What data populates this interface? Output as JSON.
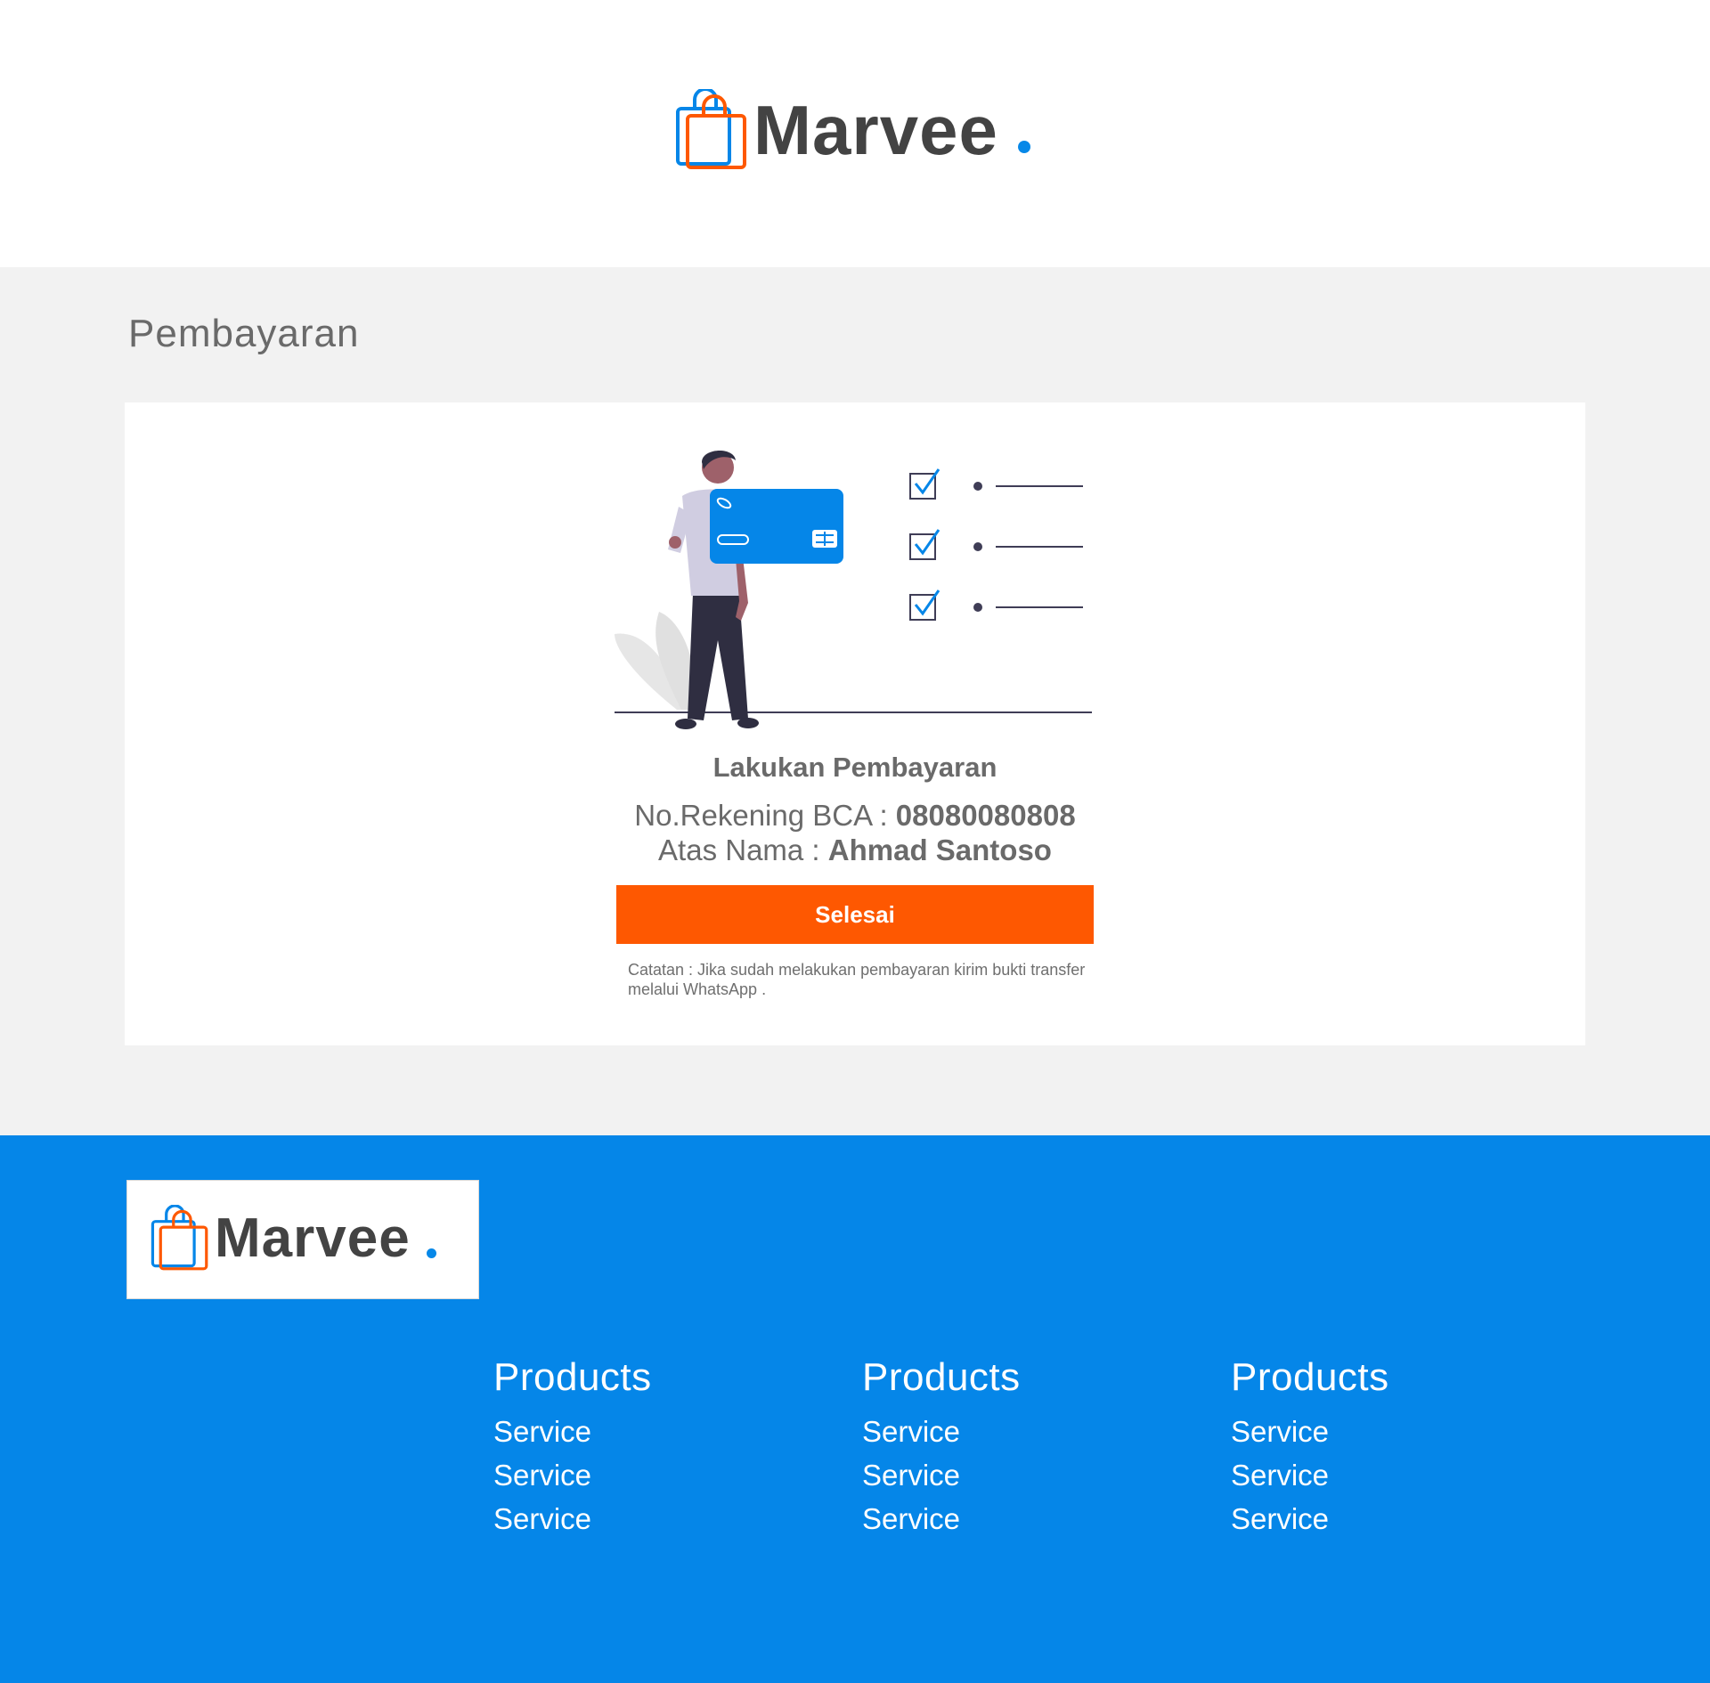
{
  "brand": {
    "name": "Marvee",
    "colors": {
      "primary": "#0586e8",
      "accent": "#fe5801",
      "text": "#434343"
    }
  },
  "payment": {
    "section_title": "Pembayaran",
    "heading": "Lakukan Pembayaran",
    "account_label": "No.Rekening BCA : ",
    "account_number": "08080080808",
    "name_label": "Atas Nama : ",
    "account_name": "Ahmad Santoso",
    "done_button": "Selesai",
    "note": "Catatan : Jika sudah melakukan pembayaran kirim bukti transfer melalui WhatsApp ."
  },
  "footer": {
    "columns": [
      {
        "title": "Products",
        "links": [
          "Service",
          "Service",
          "Service"
        ]
      },
      {
        "title": "Products",
        "links": [
          "Service",
          "Service",
          "Service"
        ]
      },
      {
        "title": "Products",
        "links": [
          "Service",
          "Service",
          "Service"
        ]
      }
    ]
  },
  "icons": [
    "shopping-bag-icon",
    "checkbox-icon",
    "credit-card-icon"
  ]
}
